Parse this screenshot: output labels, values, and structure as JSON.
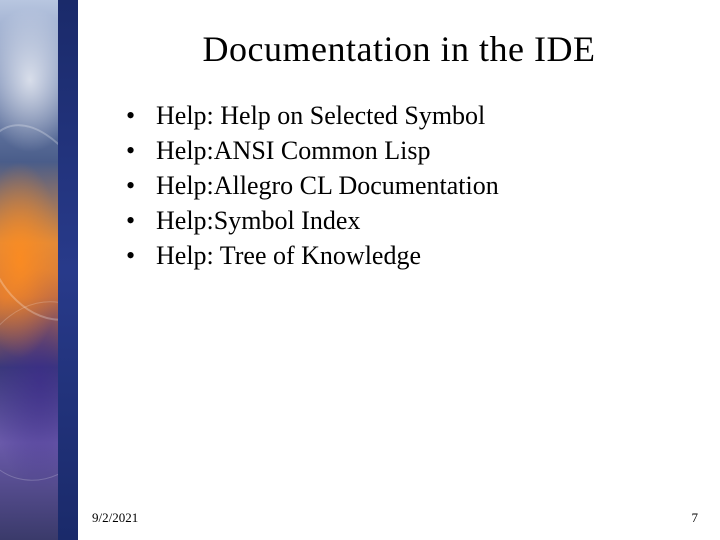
{
  "slide": {
    "title": "Documentation in the IDE",
    "bullets": [
      "Help: Help on Selected Symbol",
      "Help:ANSI Common Lisp",
      "Help:Allegro CL Documentation",
      "Help:Symbol Index",
      "Help: Tree of Knowledge"
    ]
  },
  "footer": {
    "date": "9/2/2021",
    "page": "7"
  }
}
